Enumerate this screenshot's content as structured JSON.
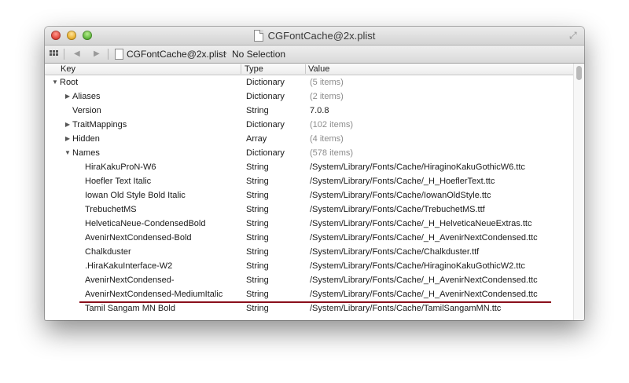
{
  "window": {
    "title": "CGFontCache@2x.plist"
  },
  "pathbar": {
    "file": "CGFontCache@2x.plist",
    "chevron": "›",
    "selection": "No Selection"
  },
  "columns": {
    "key": "Key",
    "type": "Type",
    "value": "Value"
  },
  "rows": [
    {
      "disclosure": "▼",
      "key": "Root",
      "type": "Dictionary",
      "value": "(5 items)",
      "meta": true
    },
    {
      "disclosure": "▶",
      "key": "Aliases",
      "type": "Dictionary",
      "value": "(2 items)",
      "meta": true
    },
    {
      "disclosure": "",
      "key": "Version",
      "type": "String",
      "value": "7.0.8",
      "meta": false
    },
    {
      "disclosure": "▶",
      "key": "TraitMappings",
      "type": "Dictionary",
      "value": "(102 items)",
      "meta": true
    },
    {
      "disclosure": "▶",
      "key": "Hidden",
      "type": "Array",
      "value": "(4 items)",
      "meta": true
    },
    {
      "disclosure": "▼",
      "key": "Names",
      "type": "Dictionary",
      "value": "(578 items)",
      "meta": true
    },
    {
      "disclosure": "",
      "key": "HiraKakuProN-W6",
      "type": "String",
      "value": "/System/Library/Fonts/Cache/HiraginoKakuGothicW6.ttc",
      "meta": false
    },
    {
      "disclosure": "",
      "key": "Hoefler Text Italic",
      "type": "String",
      "value": "/System/Library/Fonts/Cache/_H_HoeflerText.ttc",
      "meta": false
    },
    {
      "disclosure": "",
      "key": "Iowan Old Style Bold Italic",
      "type": "String",
      "value": "/System/Library/Fonts/Cache/IowanOldStyle.ttc",
      "meta": false
    },
    {
      "disclosure": "",
      "key": "TrebuchetMS",
      "type": "String",
      "value": "/System/Library/Fonts/Cache/TrebuchetMS.ttf",
      "meta": false
    },
    {
      "disclosure": "",
      "key": "HelveticaNeue-CondensedBold",
      "type": "String",
      "value": "/System/Library/Fonts/Cache/_H_HelveticaNeueExtras.ttc",
      "meta": false
    },
    {
      "disclosure": "",
      "key": "AvenirNextCondensed-Bold",
      "type": "String",
      "value": "/System/Library/Fonts/Cache/_H_AvenirNextCondensed.ttc",
      "meta": false
    },
    {
      "disclosure": "",
      "key": "Chalkduster",
      "type": "String",
      "value": "/System/Library/Fonts/Cache/Chalkduster.ttf",
      "meta": false
    },
    {
      "disclosure": "",
      "key": ".HiraKakuInterface-W2",
      "type": "String",
      "value": "/System/Library/Fonts/Cache/HiraginoKakuGothicW2.ttc",
      "meta": false
    },
    {
      "disclosure": "",
      "key": "AvenirNextCondensed-",
      "type": "String",
      "value": "/System/Library/Fonts/Cache/_H_AvenirNextCondensed.ttc",
      "meta": false
    },
    {
      "disclosure": "",
      "key": "AvenirNextCondensed-MediumItalic",
      "type": "String",
      "value": "/System/Library/Fonts/Cache/_H_AvenirNextCondensed.ttc",
      "meta": false
    },
    {
      "disclosure": "",
      "key": "Tamil Sangam MN Bold",
      "type": "String",
      "value": "/System/Library/Fonts/Cache/TamilSangamMN.ttc",
      "meta": false
    }
  ],
  "colors": {
    "meta_value": "#8c8c8c",
    "highlight_underline": "#8a0f1b"
  },
  "icons": {
    "close": "close-button",
    "minimize": "minimize-button",
    "zoom": "zoom-button",
    "fullscreen": "fullscreen-icon",
    "grid": "grid-icon",
    "back": "back-arrow-icon",
    "forward": "forward-arrow-icon",
    "document": "document-icon"
  }
}
